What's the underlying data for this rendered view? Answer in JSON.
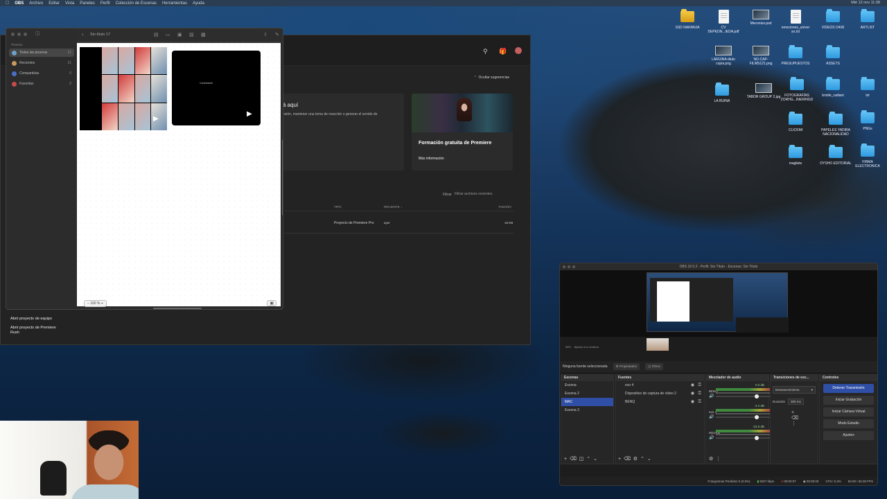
{
  "menubar": {
    "apple": "",
    "app": "OBS",
    "items": [
      "Archivo",
      "Editar",
      "Vista",
      "Paneles",
      "Perfil",
      "Colección de Escenas",
      "Herramientas",
      "Ayuda"
    ],
    "clock": "Mié 12 nov  11:08"
  },
  "desktop": {
    "icons": [
      {
        "label": "SSD NARANJA",
        "type": "folder-yellow"
      },
      {
        "label": "CV DEPEDN...IEDA.pdf",
        "type": "doc"
      },
      {
        "label": "Meconios.psd",
        "type": "image"
      },
      {
        "label": "emociones_univer so.txt",
        "type": "doc"
      },
      {
        "label": "VIDEOS O400",
        "type": "folder"
      },
      {
        "label": "ARTLIST",
        "type": "folder"
      },
      {
        "label": "LARUINA-titulo copia.png",
        "type": "image"
      },
      {
        "label": "NO-CAP-FILMS121.png",
        "type": "image"
      },
      {
        "label": "PRESUPUESTOS",
        "type": "folder"
      },
      {
        "label": "ASSETS",
        "type": "folder"
      },
      {
        "label": "LA RUINA",
        "type": "folder"
      },
      {
        "label": "TABOR GROUP 2.jpg",
        "type": "image"
      },
      {
        "label": "FOTOGRAFÍAS ZORHG...INERINGD",
        "type": "folder"
      },
      {
        "label": "bristle_radiant",
        "type": "folder"
      },
      {
        "label": "txt",
        "type": "folder"
      },
      {
        "label": "CLICKMI",
        "type": "folder"
      },
      {
        "label": "PAPELES YADIRA NACIONALIDAD",
        "type": "folder"
      },
      {
        "label": "PNGs",
        "type": "folder"
      },
      {
        "label": "magliste",
        "type": "folder"
      },
      {
        "label": "OYSHO EDITORIAL",
        "type": "folder"
      },
      {
        "label": "FIRMA ELECTRONICA",
        "type": "folder"
      }
    ]
  },
  "premiere": {
    "suggestions_toggle": "Ocultar sugerencias",
    "card1_title": "á aquí",
    "card1_text": "nsión, mantener una toma de reacción o generar el sonido de",
    "card2_title": "Formación gratuita de Premiere",
    "card2_link": "Más información",
    "filter_label": "Filtrar",
    "filter_placeholder": "Filtrar archivos recientes",
    "columns": {
      "type": "TIPO",
      "recent": "RECIENTE",
      "size": "TAMAÑO"
    },
    "row": {
      "type": "Proyecto de Premiere Pro",
      "recent": "ayer",
      "size": "19 KB"
    },
    "footer_team": "Abrir proyecto de equipo",
    "footer_rush": "Abrir proyecto de Premiere Rush"
  },
  "freeform": {
    "section": "Pizarras",
    "items": [
      {
        "label": "Todas las pizarras",
        "count": "21",
        "color": "#6fa0c8"
      },
      {
        "label": "Recientes",
        "count": "21",
        "color": "#c89a5a"
      },
      {
        "label": "Compartidas",
        "count": "0",
        "color": "#4a6fc8"
      },
      {
        "label": "Favoritas",
        "count": "0",
        "color": "#c84a4a"
      }
    ],
    "title": "Sin título 17",
    "back": "‹",
    "clip2_text": "Conectando",
    "zoom": "100 %"
  },
  "obs": {
    "title": "OBS 32.0.2 - Perfil: Sin Título - Escenas: Sin Título",
    "zoom_label": "58%",
    "fit_label": "Ajustar a la ventana",
    "no_source": "Ninguna fuente seleccionada",
    "properties": "Propiedades",
    "filters": "Filtros",
    "docks": {
      "scenes": {
        "title": "Escenas",
        "items": [
          "Escena",
          "Escena 2",
          "MAC",
          "Escena 3"
        ],
        "selected": 2
      },
      "sources": {
        "title": "Fuentes",
        "items": [
          "evo 4",
          "Dispositivo de captura de vídeo 2",
          "BENQ"
        ]
      },
      "mixer": {
        "title": "Mezclador de audio",
        "channels": [
          {
            "name": "BENQ",
            "db": "0.0 dB"
          },
          {
            "name": "evo 4",
            "db": "-2.2 dB"
          },
          {
            "name": "Mic/Aux",
            "db": "-23.6 dB"
          }
        ]
      },
      "transitions": {
        "title": "Transiciones de esc...",
        "type": "Desvanecimiento",
        "duration_label": "Duración",
        "duration": "300 ms"
      },
      "controls": {
        "title": "Controles",
        "buttons": [
          "Detener Transmisión",
          "Iniciar Grabación",
          "Iniciar Cámara Virtual",
          "Modo Estudio",
          "Ajustes"
        ]
      }
    },
    "status": {
      "frames": "Fotogramas Perdidos 0 (0.0%)",
      "kbps": "5027 kbps",
      "stream": "00:00:07",
      "rec": "00:00:00",
      "cpu": "CPU: 5.3%",
      "fps": "60.00 / 60.00 FPS"
    }
  }
}
